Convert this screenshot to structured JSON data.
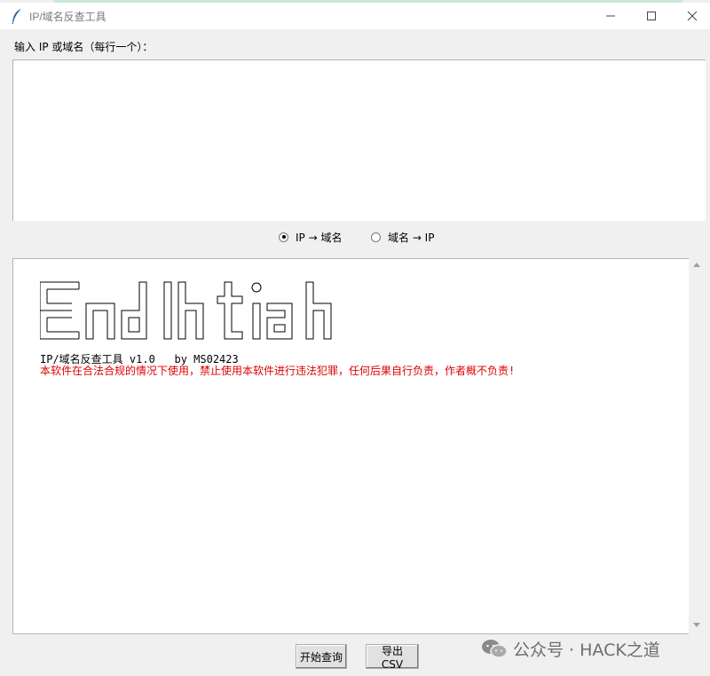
{
  "window": {
    "title": "IP/域名反查工具"
  },
  "input": {
    "label": "输入 IP 或域名（每行一个）：",
    "value": ""
  },
  "mode": {
    "options": [
      {
        "label": "IP → 域名",
        "selected": true
      },
      {
        "label": "域名 → IP",
        "selected": false
      }
    ]
  },
  "output": {
    "version_line": "IP/域名反查工具 v1.0   by MS02423",
    "warning": "本软件在合法合规的情况下使用，禁止使用本软件进行违法犯罪，任何后果自行负责，作者概不负责!",
    "warning_color": "#e00000"
  },
  "buttons": {
    "start": "开始查询",
    "export": "导出 CSV"
  },
  "watermark": {
    "text": "公众号 · HACK之道"
  }
}
